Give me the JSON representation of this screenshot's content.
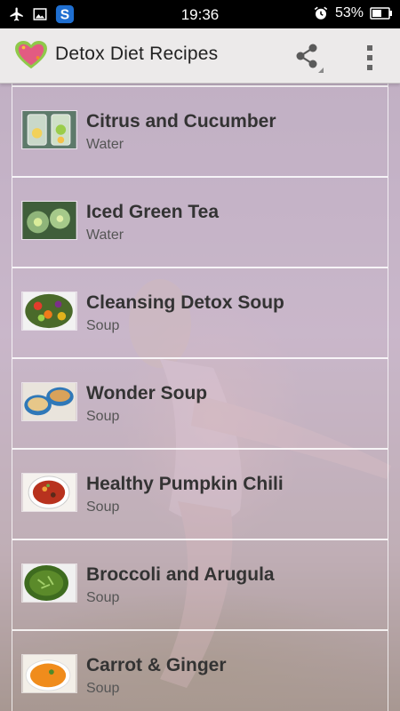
{
  "status_bar": {
    "time": "19:36",
    "battery_percent": "53%",
    "left_icons": [
      "airplane-icon",
      "image-icon",
      "s-app-icon"
    ],
    "right_icons": [
      "alarm-icon",
      "battery-icon"
    ]
  },
  "app_bar": {
    "logo_text": "Detox",
    "title": "Detox Diet Recipes",
    "actions": [
      "share-icon",
      "overflow-menu-icon"
    ]
  },
  "recipes": [
    {
      "title": "Citrus and Cucumber",
      "category": "Water",
      "thumb": "glass-drink"
    },
    {
      "title": "Iced Green Tea",
      "category": "Water",
      "thumb": "green-glass"
    },
    {
      "title": "Cleansing Detox Soup",
      "category": "Soup",
      "thumb": "vegetable-bowl"
    },
    {
      "title": "Wonder Soup",
      "category": "Soup",
      "thumb": "two-bowls"
    },
    {
      "title": "Healthy Pumpkin Chili",
      "category": "Soup",
      "thumb": "chili-bowl"
    },
    {
      "title": "Broccoli and Arugula",
      "category": "Soup",
      "thumb": "green-soup"
    },
    {
      "title": "Carrot & Ginger",
      "category": "Soup",
      "thumb": "orange-soup"
    }
  ],
  "colors": {
    "app_bar_bg": "#eceaea",
    "overlay_tint": "#cdaac8",
    "title_text": "#333333",
    "subtitle_text": "#555555"
  }
}
